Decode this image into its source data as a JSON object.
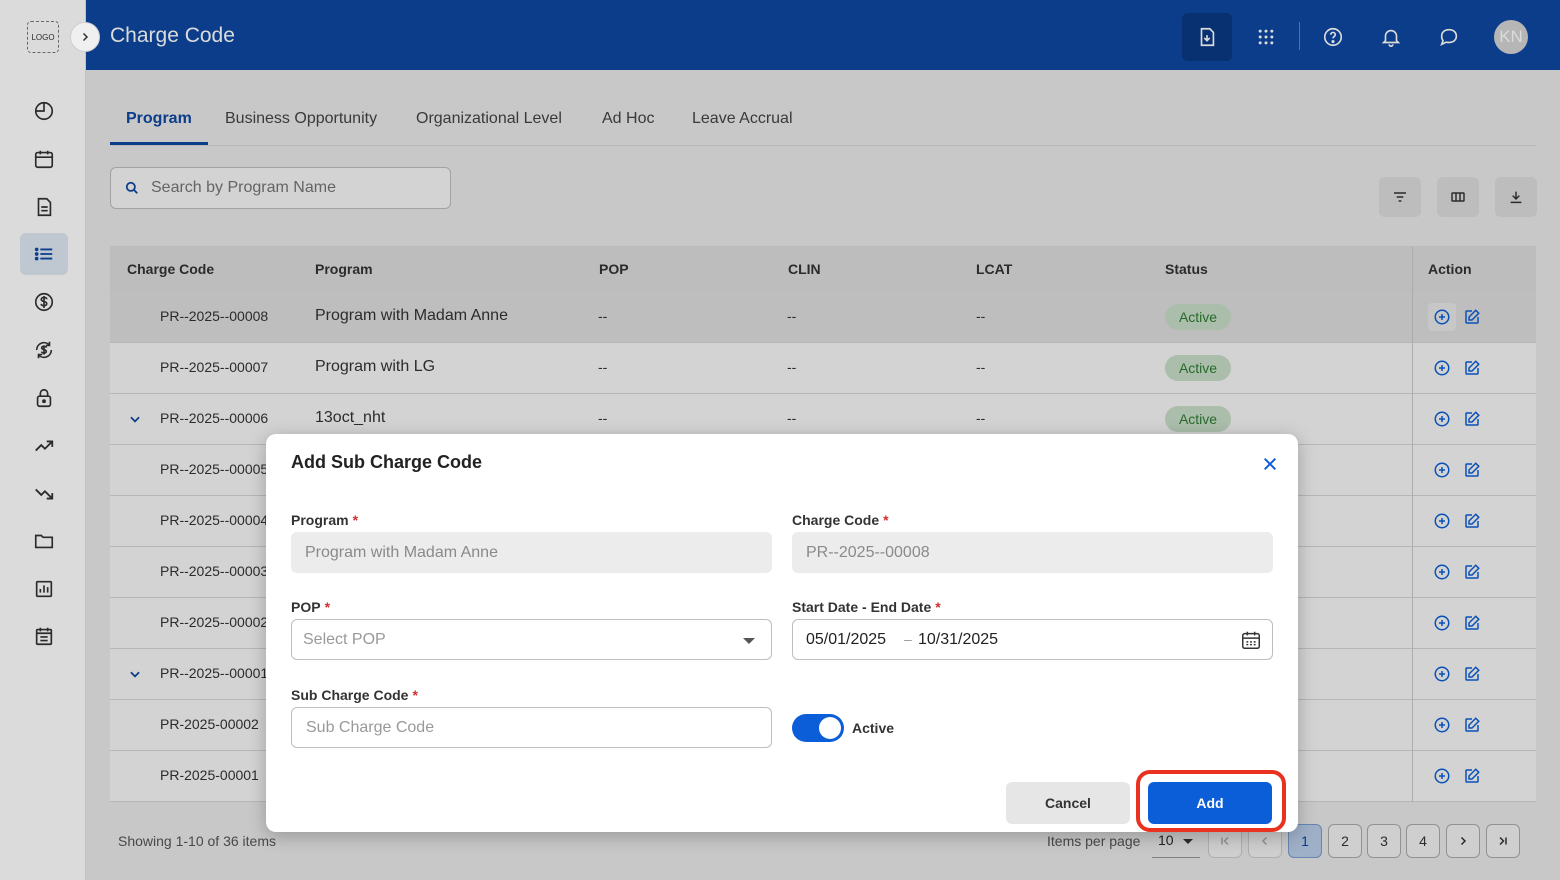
{
  "sidebar": {
    "logo_text": "LOGO"
  },
  "header": {
    "title": "Charge Code",
    "avatar_initials": "KN"
  },
  "tabs": [
    {
      "label": "Program"
    },
    {
      "label": "Business Opportunity"
    },
    {
      "label": "Organizational Level"
    },
    {
      "label": "Ad Hoc"
    },
    {
      "label": "Leave Accrual"
    }
  ],
  "search": {
    "placeholder": "Search by Program Name"
  },
  "table": {
    "columns": [
      "Charge Code",
      "Program",
      "POP",
      "CLIN",
      "LCAT",
      "Status",
      "Action"
    ],
    "rows": [
      {
        "code": "PR--2025--00008",
        "program": "Program with Madam Anne",
        "pop": "--",
        "clin": "--",
        "lcat": "--",
        "status": "Active"
      },
      {
        "code": "PR--2025--00007",
        "program": "Program with LG",
        "pop": "--",
        "clin": "--",
        "lcat": "--",
        "status": "Active"
      },
      {
        "code": "PR--2025--00006",
        "program": "13oct_nht",
        "pop": "--",
        "clin": "--",
        "lcat": "--",
        "status": "Active"
      },
      {
        "code": "PR--2025--00005"
      },
      {
        "code": "PR--2025--00004"
      },
      {
        "code": "PR--2025--00003"
      },
      {
        "code": "PR--2025--00002"
      },
      {
        "code": "PR--2025--00001"
      },
      {
        "code": "PR-2025-00002"
      },
      {
        "code": "PR-2025-00001"
      }
    ]
  },
  "footer": {
    "showing": "Showing 1-10 of 36 items",
    "items_per_page_label": "Items per page",
    "items_per_page_value": "10",
    "pages": [
      "1",
      "2",
      "3",
      "4"
    ],
    "current_page": "1"
  },
  "modal": {
    "title": "Add Sub Charge Code",
    "program_label": "Program",
    "program_value": "Program with Madam Anne",
    "charge_code_label": "Charge Code",
    "charge_code_value": "PR--2025--00008",
    "pop_label": "POP",
    "pop_placeholder": "Select POP",
    "date_label": "Start Date - End Date",
    "start_date": "05/01/2025",
    "date_separator": "–",
    "end_date": "10/31/2025",
    "sub_code_label": "Sub Charge Code",
    "sub_code_placeholder": "Sub Charge Code",
    "active_label": "Active",
    "active_on": true,
    "cancel_label": "Cancel",
    "add_label": "Add",
    "required_mark": "*"
  },
  "colors": {
    "primary": "#0d47a1",
    "button_blue": "#0b5ed7",
    "status_green": "#2e7d32",
    "required_red": "#d32f2f",
    "highlight_ring": "#e8321f"
  }
}
